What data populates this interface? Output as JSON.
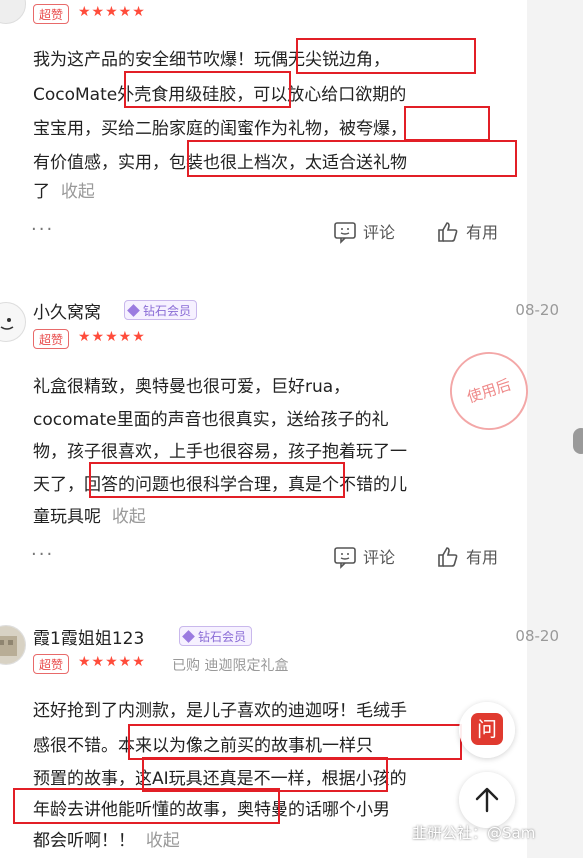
{
  "reviews": [
    {
      "badge": "超赞",
      "stars": "★★★★★",
      "lines": [
        "我为这产品的安全细节吹爆！玩偶无尖锐边角，",
        "CocoMate外壳食用级硅胶，可以放心给口欲期的",
        "宝宝用，买给二胎家庭的闺蜜作为礼物，被夸爆，",
        "有价值感，实用，包装也很上档次，太适合送礼物",
        "了"
      ],
      "collapse": "收起",
      "more": "···",
      "comment": "评论",
      "useful": "有用"
    },
    {
      "username": "小久窝窝",
      "member": "钻石会员",
      "date": "08-20",
      "badge": "超赞",
      "stars": "★★★★★",
      "lines": [
        "礼盒很精致，奥特曼也很可爱，巨好rua，",
        "cocomate里面的声音也很真实，送给孩子的礼",
        "物，孩子很喜欢，上手也很容易，孩子抱着玩了一",
        "天了，回答的问题也很科学合理，真是个不错的儿",
        "童玩具呢"
      ],
      "collapse": "收起",
      "stamp": "使用后",
      "more": "···",
      "comment": "评论",
      "useful": "有用"
    },
    {
      "username": "霞1霞姐姐123",
      "member": "钻石会员",
      "date": "08-20",
      "badge": "超赞",
      "stars": "★★★★★",
      "purchase": "已购 迪迦限定礼盒",
      "lines": [
        "还好抢到了内测款，是儿子喜欢的迪迦呀！毛绒手",
        "感很不错。本来以为像之前买的故事机一样只",
        "预置的故事，这AI玩具还真是不一样，根据小孩的",
        "年龄去讲他能听懂的故事，奥特曼的话哪个小男",
        "都会听啊！！"
      ],
      "collapse": "收起"
    }
  ],
  "fab": {
    "ask": "问"
  },
  "watermark": "韭研公社：@Sam",
  "colors": {
    "highlight": "#e21f26",
    "star": "#ff4c3b",
    "member": "#8a6cd6"
  }
}
